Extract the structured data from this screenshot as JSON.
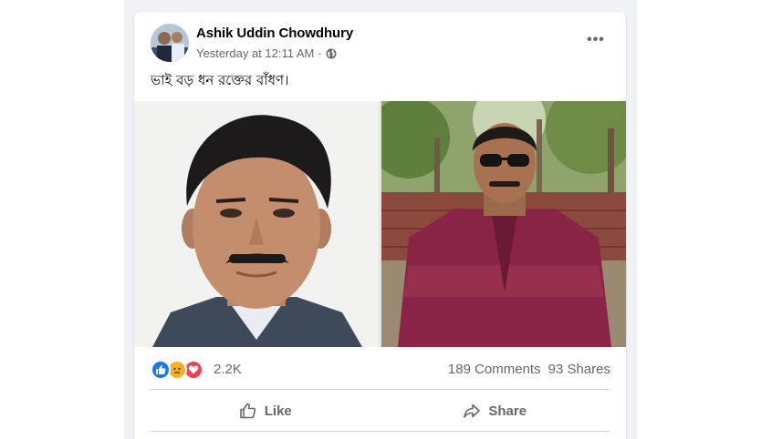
{
  "post": {
    "author": "Ashik Uddin Chowdhury",
    "timestamp": "Yesterday at 12:11 AM",
    "separator": "·",
    "privacy_icon": "globe-icon",
    "more_label": "•••",
    "text": "ভাই বড় ধন রক্তের বাঁধণ।"
  },
  "reactions": {
    "icons": [
      "like-icon",
      "sad-icon",
      "love-icon"
    ],
    "count": "2.2K",
    "comments": "189 Comments",
    "shares": "93 Shares"
  },
  "actions": {
    "like_label": "Like",
    "share_label": "Share"
  },
  "colors": {
    "like_blue": "#1877f2",
    "sad_yellow": "#f7b125",
    "love_red": "#f33e58",
    "secondary_text": "#65676b"
  }
}
